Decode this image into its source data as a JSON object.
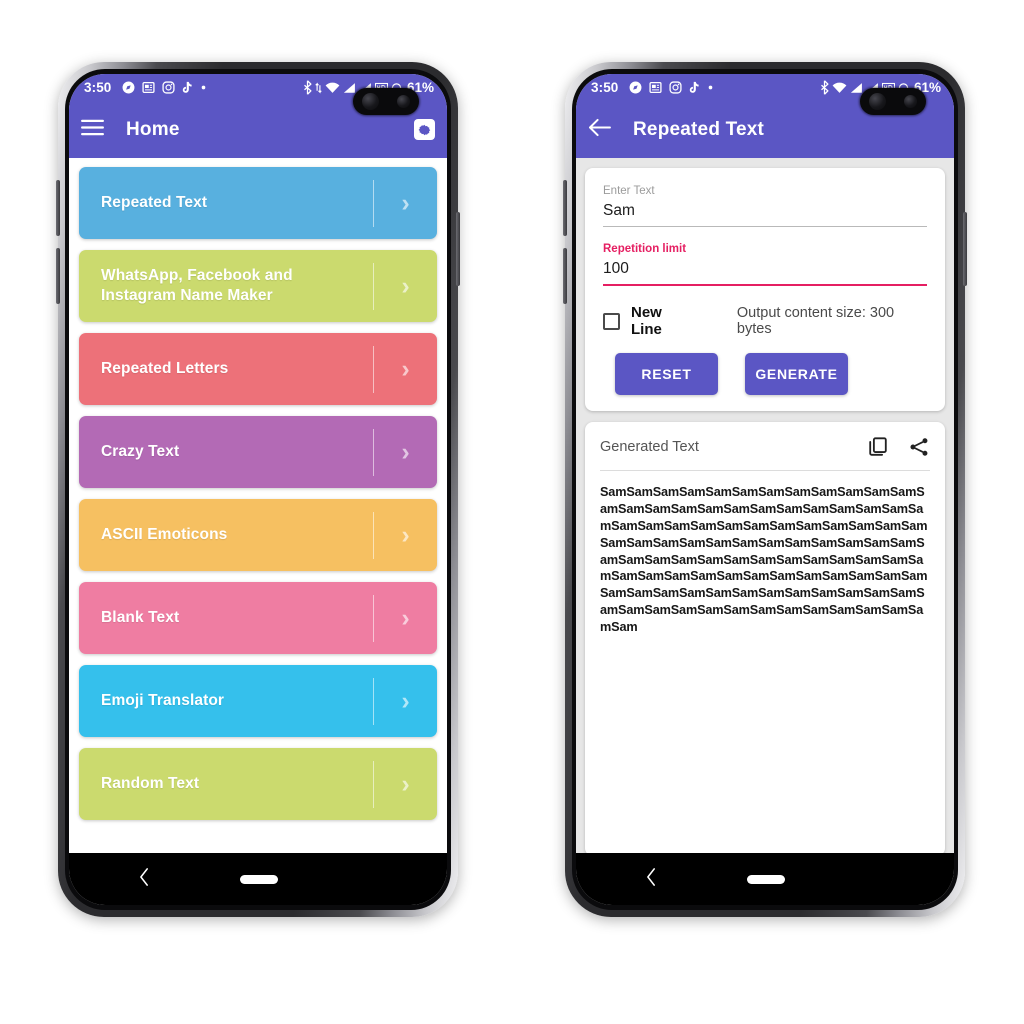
{
  "status_bar": {
    "time": "3:50",
    "battery_percent": "61%",
    "left_icons": [
      "compass-icon",
      "news-icon",
      "instagram-icon",
      "tiktok-icon",
      "dot-icon"
    ],
    "right_icons": [
      "bluetooth-icon",
      "data-transfer-icon",
      "wifi-icon",
      "signal-icon",
      "signal-icon",
      "hd-icon",
      "headset-icon"
    ],
    "background": "#5b56c4"
  },
  "home_screen": {
    "appbar": {
      "menu_icon": "hamburger-menu-icon",
      "title": "Home",
      "settings_icon": "gear-icon",
      "background": "#5b56c4"
    },
    "chevron": "›",
    "tiles": [
      {
        "label": "Repeated Text",
        "color": "#58b0df"
      },
      {
        "label": "WhatsApp, Facebook and Instagram Name Maker",
        "color": "#cbda6e"
      },
      {
        "label": "Repeated Letters",
        "color": "#ed7179"
      },
      {
        "label": "Crazy Text",
        "color": "#b濃"
      },
      {
        "label": "ASCII Emoticons",
        "color": "#f6c061"
      },
      {
        "label": "Blank Text",
        "color": "#ef7da2"
      },
      {
        "label": "Emoji Translator",
        "color": "#35c0ec"
      },
      {
        "label": "Random Text",
        "color": "#cbda6e"
      }
    ]
  },
  "detail_screen": {
    "appbar": {
      "back_icon": "arrow-left-icon",
      "title": "Repeated Text",
      "background": "#5b56c4"
    },
    "form": {
      "enter_text_label": "Enter Text",
      "enter_text_value": "Sam",
      "repetition_label": "Repetition limit",
      "repetition_value": "100",
      "accent_color": "#e51f62",
      "new_line_label": "New Line",
      "new_line_checked": false,
      "output_size_text": "Output content size: 300 bytes",
      "reset_label": "RESET",
      "generate_label": "GENERATE",
      "button_color": "#5b56c4"
    },
    "output": {
      "title": "Generated Text",
      "copy_icon": "copy-icon",
      "share_icon": "share-icon",
      "text": "SamSamSamSamSamSamSamSamSamSamSamSamSamSamSamSamSamSamSamSamSamSamSamSamSamSamSamSamSamSamSamSamSamSamSamSamSamSamSamSamSamSamSamSamSamSamSamSamSamSamSamSamSamSamSamSamSamSamSamSamSamSamSamSamSamSamSamSamSamSamSamSamSamSamSamSamSamSamSamSamSamSamSamSamSamSamSamSamSamSamSamSamSamSamSamSamSamSamSamSam"
    }
  },
  "nav_bar": {
    "back_icon": "chevron-left-icon",
    "home_pill": "home-pill-indicator"
  }
}
